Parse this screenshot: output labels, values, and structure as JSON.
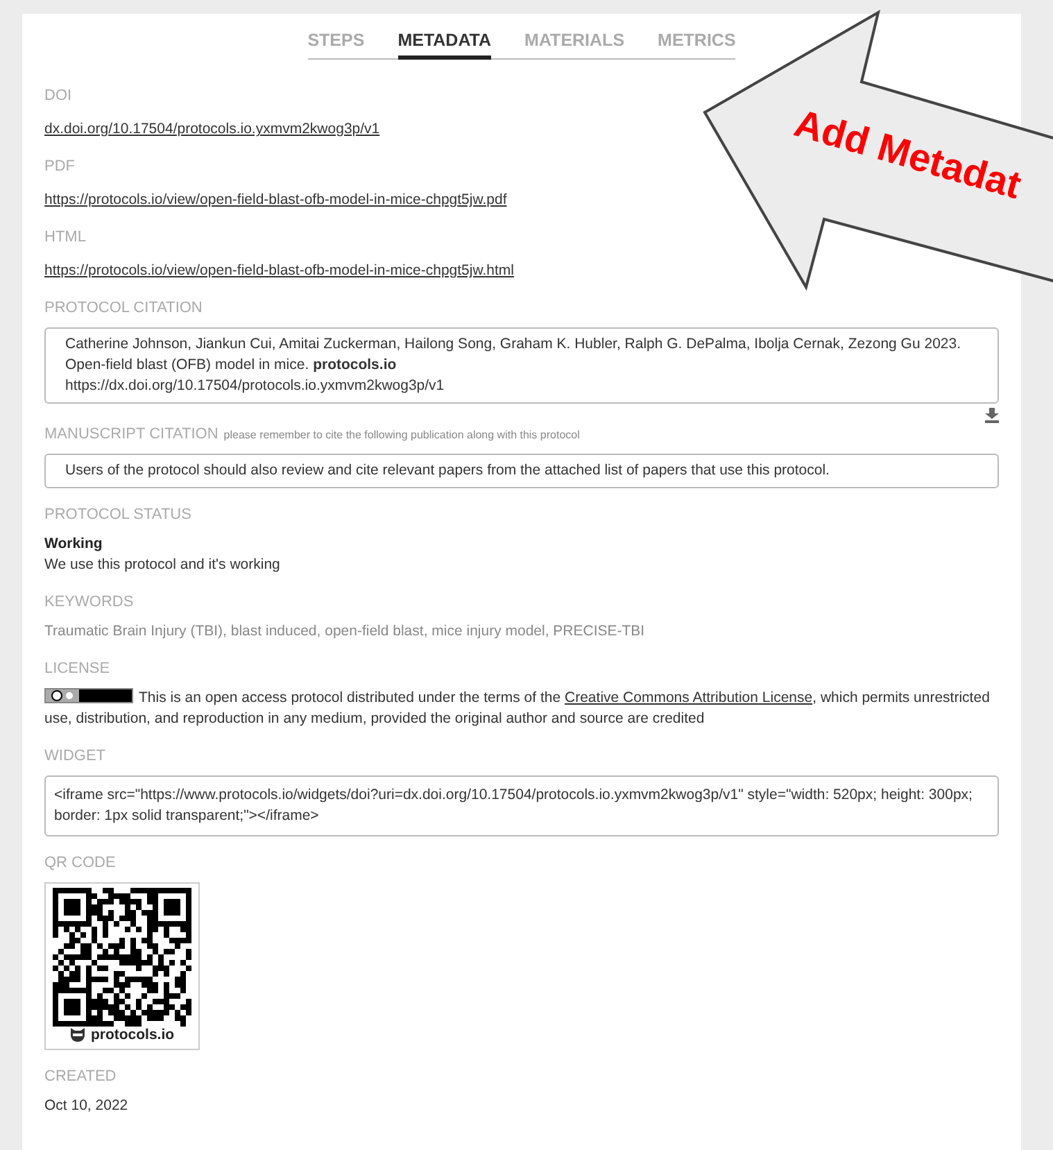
{
  "tabs": [
    {
      "label": "STEPS",
      "selected": false
    },
    {
      "label": "METADATA",
      "selected": true
    },
    {
      "label": "MATERIALS",
      "selected": false
    },
    {
      "label": "METRICS",
      "selected": false
    }
  ],
  "sections": [
    {
      "kind": "link",
      "label": "DOI",
      "value": "dx.doi.org/10.17504/protocols.io.yxmvm2kwog3p/v1"
    },
    {
      "kind": "link",
      "label": "PDF",
      "value": "https://protocols.io/view/open-field-blast-ofb-model-in-mice-chpgt5jw.pdf"
    },
    {
      "kind": "link",
      "label": "HTML",
      "value": "https://protocols.io/view/open-field-blast-ofb-model-in-mice-chpgt5jw.html"
    },
    {
      "kind": "citation",
      "label": "PROTOCOL CITATION",
      "lines": [
        "Catherine Johnson, Jiankun Cui, Amitai Zuckerman, Hailong Song, Graham K. Hubler, Ralph G. DePalma, Ibolja Cernak, Zezong Gu 2023. Open-field blast (OFB) model in mice. **protocols.io**",
        "https://dx.doi.org/10.17504/protocols.io.yxmvm2kwog3p/v1"
      ]
    },
    {
      "kind": "box",
      "label": "MANUSCRIPT CITATION",
      "note": "please remember to cite the following publication along with this protocol",
      "value": "Users of the protocol should also review and cite relevant papers from the attached list of papers that use this protocol."
    },
    {
      "kind": "status",
      "label": "PROTOCOL STATUS",
      "title": "Working",
      "value": "We use this protocol and it's working"
    },
    {
      "kind": "text",
      "label": "KEYWORDS",
      "value": "Traumatic Brain Injury (TBI), blast induced, open-field blast, mice injury model, PRECISE-TBI"
    },
    {
      "kind": "license",
      "label": "LICENSE",
      "before": "This is an open access protocol distributed under the terms of the",
      "link": "Creative Commons Attribution License",
      "after": ",  which permits unrestricted use, distribution, and reproduction in any medium, provided the original author and source are credited"
    },
    {
      "kind": "code",
      "label": "WIDGET",
      "value": "<iframe src=\"https://www.protocols.io/widgets/doi?uri=dx.doi.org/10.17504/protocols.io.yxmvm2kwog3p/v1\" style=\"width: 520px; height: 300px; border: 1px solid transparent;\"></iframe>"
    },
    {
      "kind": "qr",
      "label": "QR CODE",
      "caption": "protocols.io"
    },
    {
      "kind": "date",
      "label": "CREATED",
      "value": "Oct 10, 2022"
    }
  ],
  "callout": {
    "text": "Add Metadat"
  }
}
